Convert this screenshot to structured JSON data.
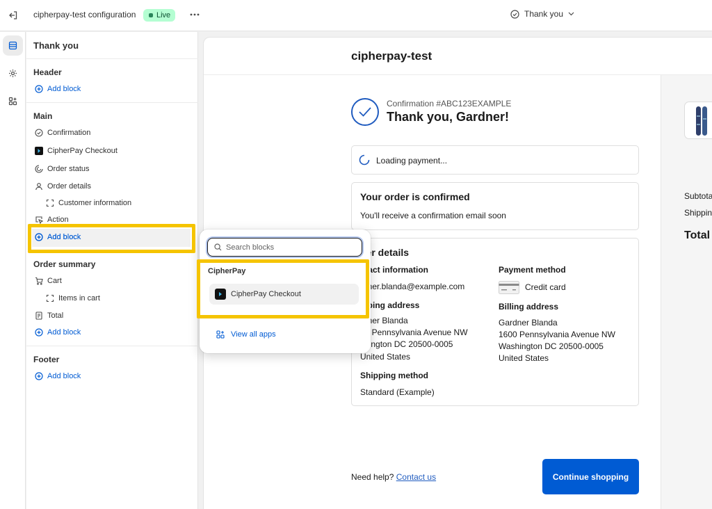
{
  "topbar": {
    "title": "cipherpay-test configuration",
    "status_badge": "Live",
    "page_selector": "Thank you"
  },
  "rail": {
    "items": [
      {
        "icon": "sections-icon",
        "active": true
      },
      {
        "icon": "settings-gear-icon",
        "active": false
      },
      {
        "icon": "apps-icon",
        "active": false
      }
    ]
  },
  "sidebar": {
    "title": "Thank you",
    "header": {
      "heading": "Header",
      "add_block": "Add block"
    },
    "main": {
      "heading": "Main",
      "items": {
        "confirmation": "Confirmation",
        "cipherpay": "CipherPay Checkout",
        "order_status": "Order status",
        "order_details": "Order details",
        "customer_information": "Customer information",
        "action": "Action"
      },
      "add_block": "Add block"
    },
    "order_summary": {
      "heading": "Order summary",
      "items": {
        "cart": "Cart",
        "items_in_cart": "Items in cart",
        "total": "Total"
      },
      "add_block": "Add block"
    },
    "footer": {
      "heading": "Footer",
      "add_block": "Add block"
    }
  },
  "popover": {
    "search_placeholder": "Search blocks",
    "group_label": "CipherPay",
    "item_label": "CipherPay Checkout",
    "view_all": "View all apps"
  },
  "preview": {
    "shop_name": "cipherpay-test",
    "confirmation_number": "Confirmation #ABC123EXAMPLE",
    "thank_you": "Thank you, Gardner!",
    "loading": "Loading payment...",
    "confirmed_title": "Your order is confirmed",
    "confirmed_text": "You'll receive a confirmation email soon",
    "order_details": {
      "title": "der details",
      "contact_label": "ntact information",
      "contact_value": "rdner.blanda@example.com",
      "shipping_address_label": "ipping address",
      "shipping_address": [
        "rdner Blanda",
        "00 Pennsylvania Avenue NW",
        "shington DC 20500-0005",
        "United States"
      ],
      "shipping_method_label": "Shipping method",
      "shipping_method": "Standard (Example)",
      "payment_label": "Payment method",
      "payment_value": "Credit card",
      "billing_label": "Billing address",
      "billing_address": [
        "Gardner Blanda",
        "1600 Pennsylvania Avenue NW",
        "Washington DC 20500-0005",
        "United States"
      ]
    },
    "help_text": "Need help?",
    "contact_link": "Contact us",
    "continue_button": "Continue shopping",
    "summary": {
      "subtotal": "Subtota",
      "shipping": "Shipping",
      "total": "Total"
    }
  },
  "colors": {
    "accent": "#005bd3",
    "highlight": "#f5c400",
    "live_badge": "#b4fed2"
  }
}
